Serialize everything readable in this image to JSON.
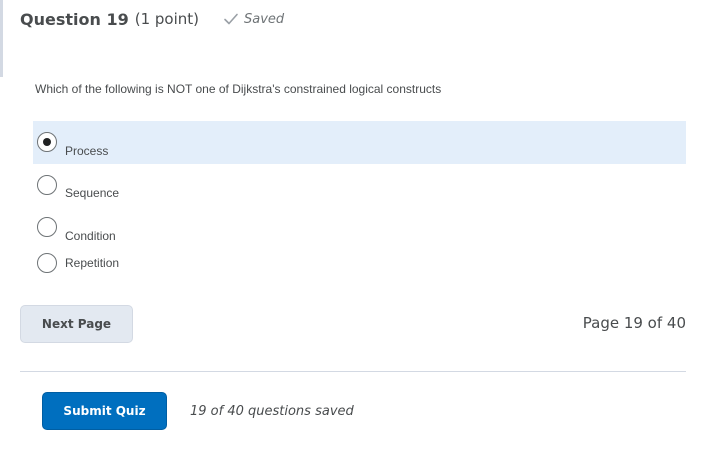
{
  "question": {
    "title": "Question 19",
    "points": "(1 point)",
    "status_text": "Saved",
    "status_icon": "check-icon",
    "prompt": "Which of the following is NOT one of Dijkstra's constrained logical constructs",
    "options": [
      {
        "label": "Process",
        "selected": true
      },
      {
        "label": "Sequence",
        "selected": false
      },
      {
        "label": "Condition",
        "selected": false
      },
      {
        "label": "Repetition",
        "selected": false
      }
    ]
  },
  "navigation": {
    "next_label": "Next Page",
    "page_indicator": "Page 19 of 40"
  },
  "footer": {
    "submit_label": "Submit Quiz",
    "saved_count": "19 of 40 questions saved"
  },
  "colors": {
    "primary": "#006fbf",
    "selected_row": "#e3eefa",
    "text": "#494c4e",
    "muted": "#6e7376"
  }
}
